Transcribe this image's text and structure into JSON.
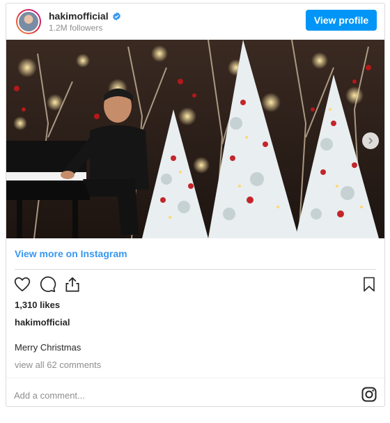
{
  "header": {
    "username": "hakimofficial",
    "followers": "1.2M followers",
    "view_profile_label": "View profile",
    "verified_icon": "verified-badge-icon",
    "accent_color": "#0095f6"
  },
  "post": {
    "view_more_label": "View more on Instagram",
    "likes": "1,310 likes",
    "caption_username": "hakimofficial",
    "caption": "Merry Christmas",
    "comments_link": "view all 62 comments"
  },
  "actions": {
    "icons": [
      "heart-icon",
      "comment-icon",
      "share-icon",
      "bookmark-icon"
    ]
  },
  "footer": {
    "comment_placeholder": "Add a comment...",
    "logo_icon": "instagram-icon"
  }
}
